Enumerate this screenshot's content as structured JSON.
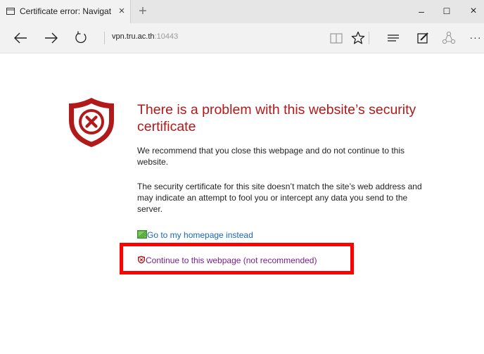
{
  "tab": {
    "title": "Certificate error: Navigat",
    "close_glyph": "×",
    "new_tab_glyph": "+"
  },
  "window_controls": {
    "minimize": "–",
    "maximize": "☐",
    "close": "×"
  },
  "address_bar": {
    "host": "vpn.tru.ac.th",
    "port": ":10443"
  },
  "toolbar": {
    "more_glyph": "···"
  },
  "page": {
    "headline": "There is a problem with this website’s security certificate",
    "paragraph_1": "We recommend that you close this webpage and do not continue to this website.",
    "paragraph_2": "The security certificate for this site doesn’t match the site’s web address and may indicate an attempt to fool you or intercept any data you send to the server.",
    "homepage_link": "Go to my homepage instead",
    "continue_link": "Continue to this webpage (not recommended)"
  },
  "colors": {
    "error_red": "#b01a1a",
    "link_blue": "#1a65c0",
    "visited_purple": "#7a1f8f",
    "highlight_box": "#ff0000"
  },
  "icons": {
    "tab_favicon": "window-icon",
    "back": "back-arrow-icon",
    "forward": "forward-arrow-icon",
    "refresh": "refresh-icon",
    "reading_view": "reading-view-icon",
    "favorite": "star-icon",
    "hub": "hub-icon",
    "web_note": "web-note-icon",
    "share": "share-icon",
    "shield": "shield-error-icon",
    "home_link": "home-icon",
    "continue_link": "small-shield-icon"
  }
}
